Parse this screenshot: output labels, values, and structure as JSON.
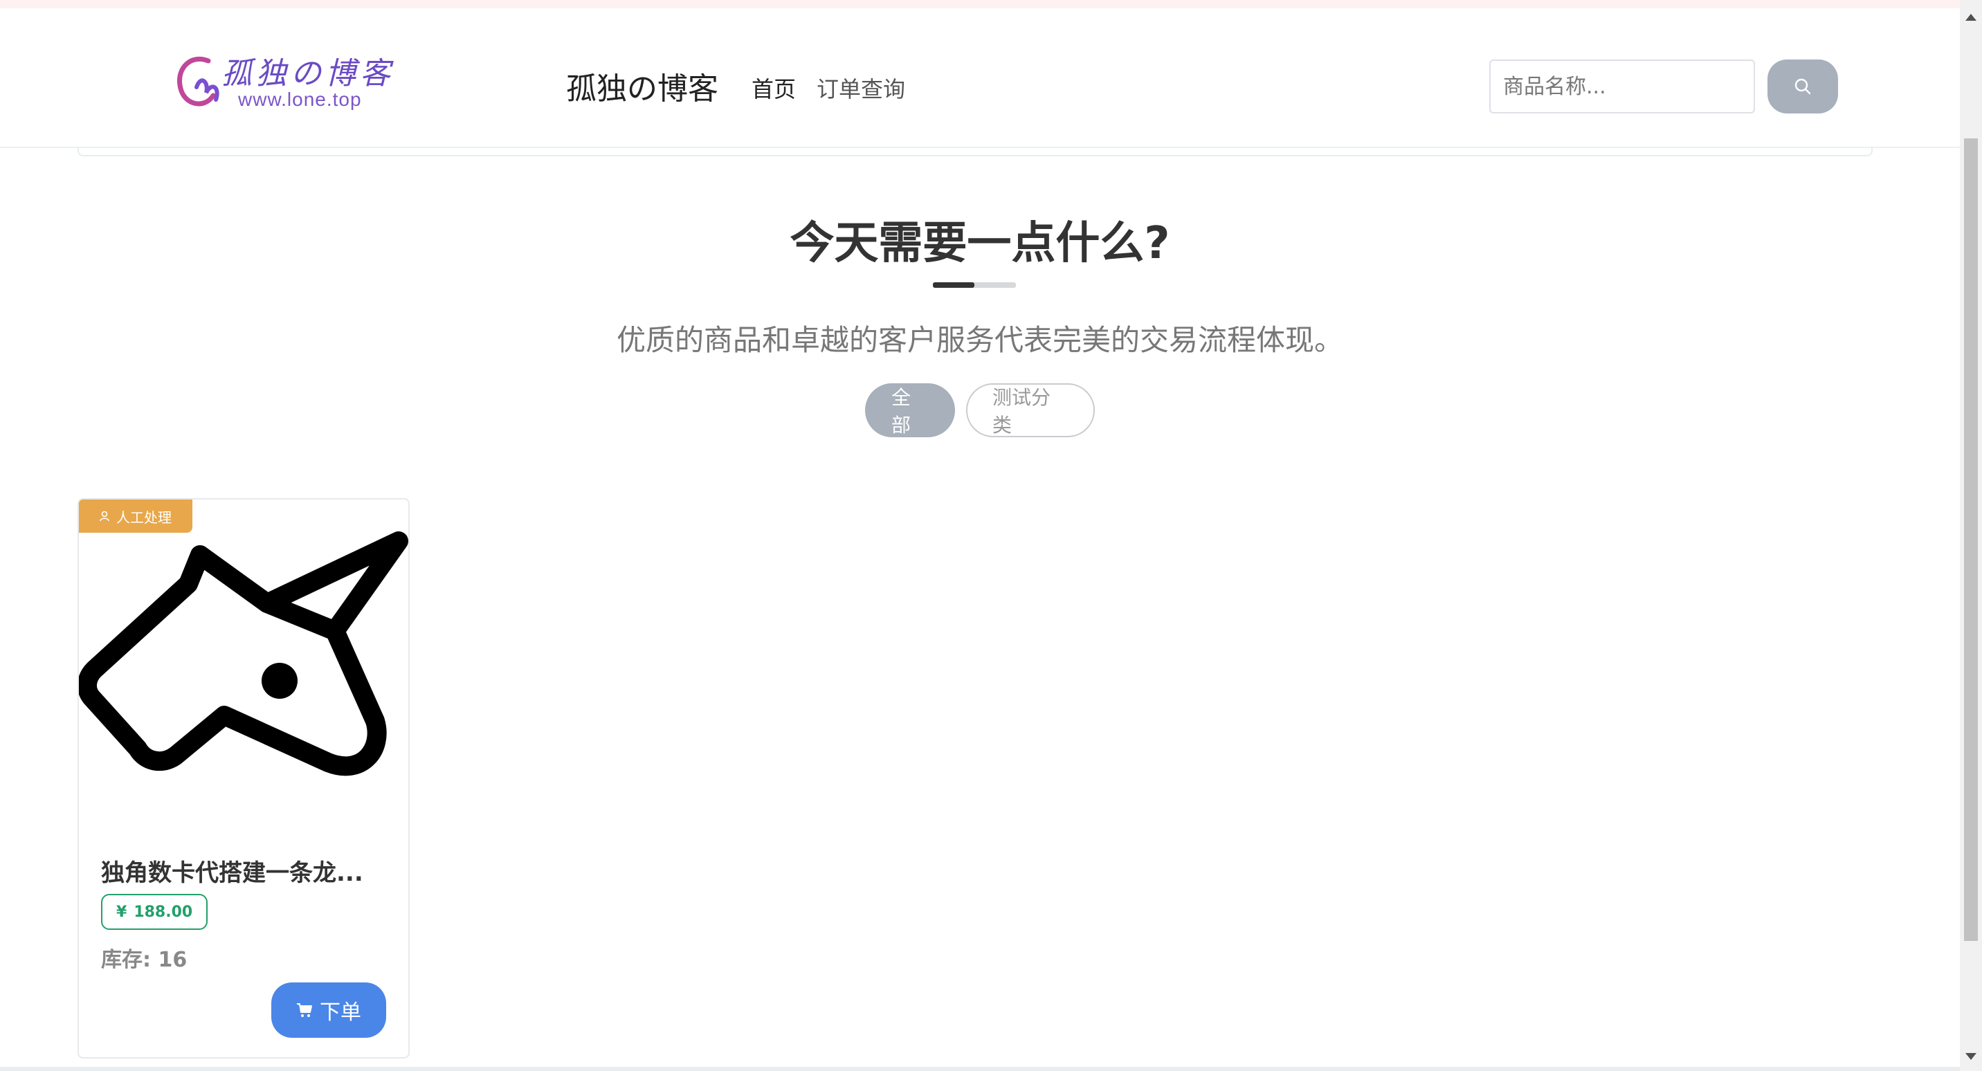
{
  "header": {
    "logo_text": "孤独の博客",
    "logo_url": "www.lone.top",
    "site_title": "孤独の博客",
    "nav": [
      {
        "label": "首页"
      },
      {
        "label": "订单查询"
      }
    ],
    "search": {
      "placeholder": "商品名称...",
      "value": "",
      "button_icon": "search-icon"
    }
  },
  "hero": {
    "title": "今天需要一点什么?",
    "subtitle": "优质的商品和卓越的客户服务代表完美的交易流程体现。"
  },
  "categories": [
    {
      "label": "全部",
      "active": true
    },
    {
      "label": "测试分类",
      "active": false
    }
  ],
  "products": [
    {
      "badge": "人工处理",
      "badge_icon": "person-icon",
      "name": "独角数卡代搭建一条龙...",
      "currency": "¥",
      "price": "188.00",
      "stock_label": "库存:",
      "stock_value": "16",
      "order_label": "下单",
      "order_icon": "cart-icon",
      "image": "unicorn-icon"
    }
  ],
  "colors": {
    "badge": "#e8a74a",
    "price": "#22a06b",
    "order_button": "#4a86e8",
    "pill_active": "#a7b0bb",
    "logo": "#6a4bc4"
  }
}
